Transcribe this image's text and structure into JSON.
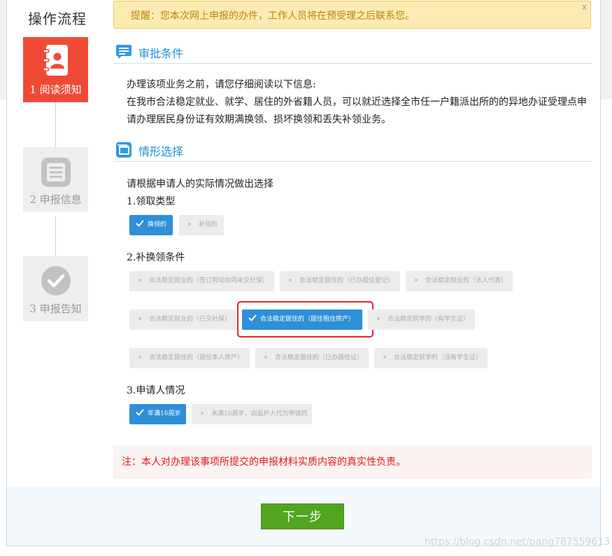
{
  "sidebar": {
    "title": "操作流程",
    "steps": [
      {
        "label": "1 阅读须知",
        "icon": "contacts-book-icon",
        "state": "active"
      },
      {
        "label": "2 申报信息",
        "icon": "document-list-icon",
        "state": "inactive"
      },
      {
        "label": "3 申报告知",
        "icon": "checkmark-circle-icon",
        "state": "inactive"
      }
    ]
  },
  "notice": {
    "text": "提醒：您本次网上申报的办件，工作人员将在预受理之后联系您。",
    "close": "x"
  },
  "approval": {
    "title": "审批条件",
    "intro": "办理该项业务之前，请您仔细阅读以下信息:",
    "body": "在我市合法稳定就业、就学、居住的外省籍人员，可以就近选择全市任一户籍派出所的的异地办证受理点申请办理居民身份证有效期满换领、损坏换领和丢失补领业务。"
  },
  "situation": {
    "title": "情形选择",
    "prompt": "请根据申请人的实际情况做出选择",
    "q1": {
      "label": "1.领取类型",
      "options": [
        {
          "text": "换领的",
          "selected": true
        },
        {
          "text": "补领的",
          "selected": false
        }
      ]
    },
    "q2": {
      "label": "2.补换领条件",
      "options": [
        {
          "text": "合法稳定就业的（签订劳动合同未交社保）",
          "selected": false
        },
        {
          "text": "合法稳定居住的（已办居住登记）",
          "selected": false
        },
        {
          "text": "合法稳定就业的（法人代表）",
          "selected": false
        },
        {
          "text": "合法稳定就业的（已交社保）",
          "selected": false
        },
        {
          "text": "合法稳定居住的（居住租住房产）",
          "selected": true
        },
        {
          "text": "合法稳定就学的（有学生证）",
          "selected": false
        },
        {
          "text": "合法稳定居住的（居住本人房产）",
          "selected": false
        },
        {
          "text": "合法稳定居住的（已办居住证）",
          "selected": false
        },
        {
          "text": "合法稳定就学的（没有学生证）",
          "selected": false
        }
      ]
    },
    "q3": {
      "label": "3.申请人情况",
      "options": [
        {
          "text": "年满16周岁",
          "selected": true
        },
        {
          "text": "未满16周岁，由监护人代为申请的",
          "selected": false
        }
      ]
    }
  },
  "warning": "注：本人对办理该事项所提交的申报材料实质内容的真实性负责。",
  "next_button": "下一步",
  "watermark": "https://blog.csdn.net/pang787559613",
  "colors": {
    "active_step": "#f04a37",
    "accent_blue": "#2f8fd8",
    "next_green": "#51a51f",
    "warning_red": "#e21a1a"
  }
}
